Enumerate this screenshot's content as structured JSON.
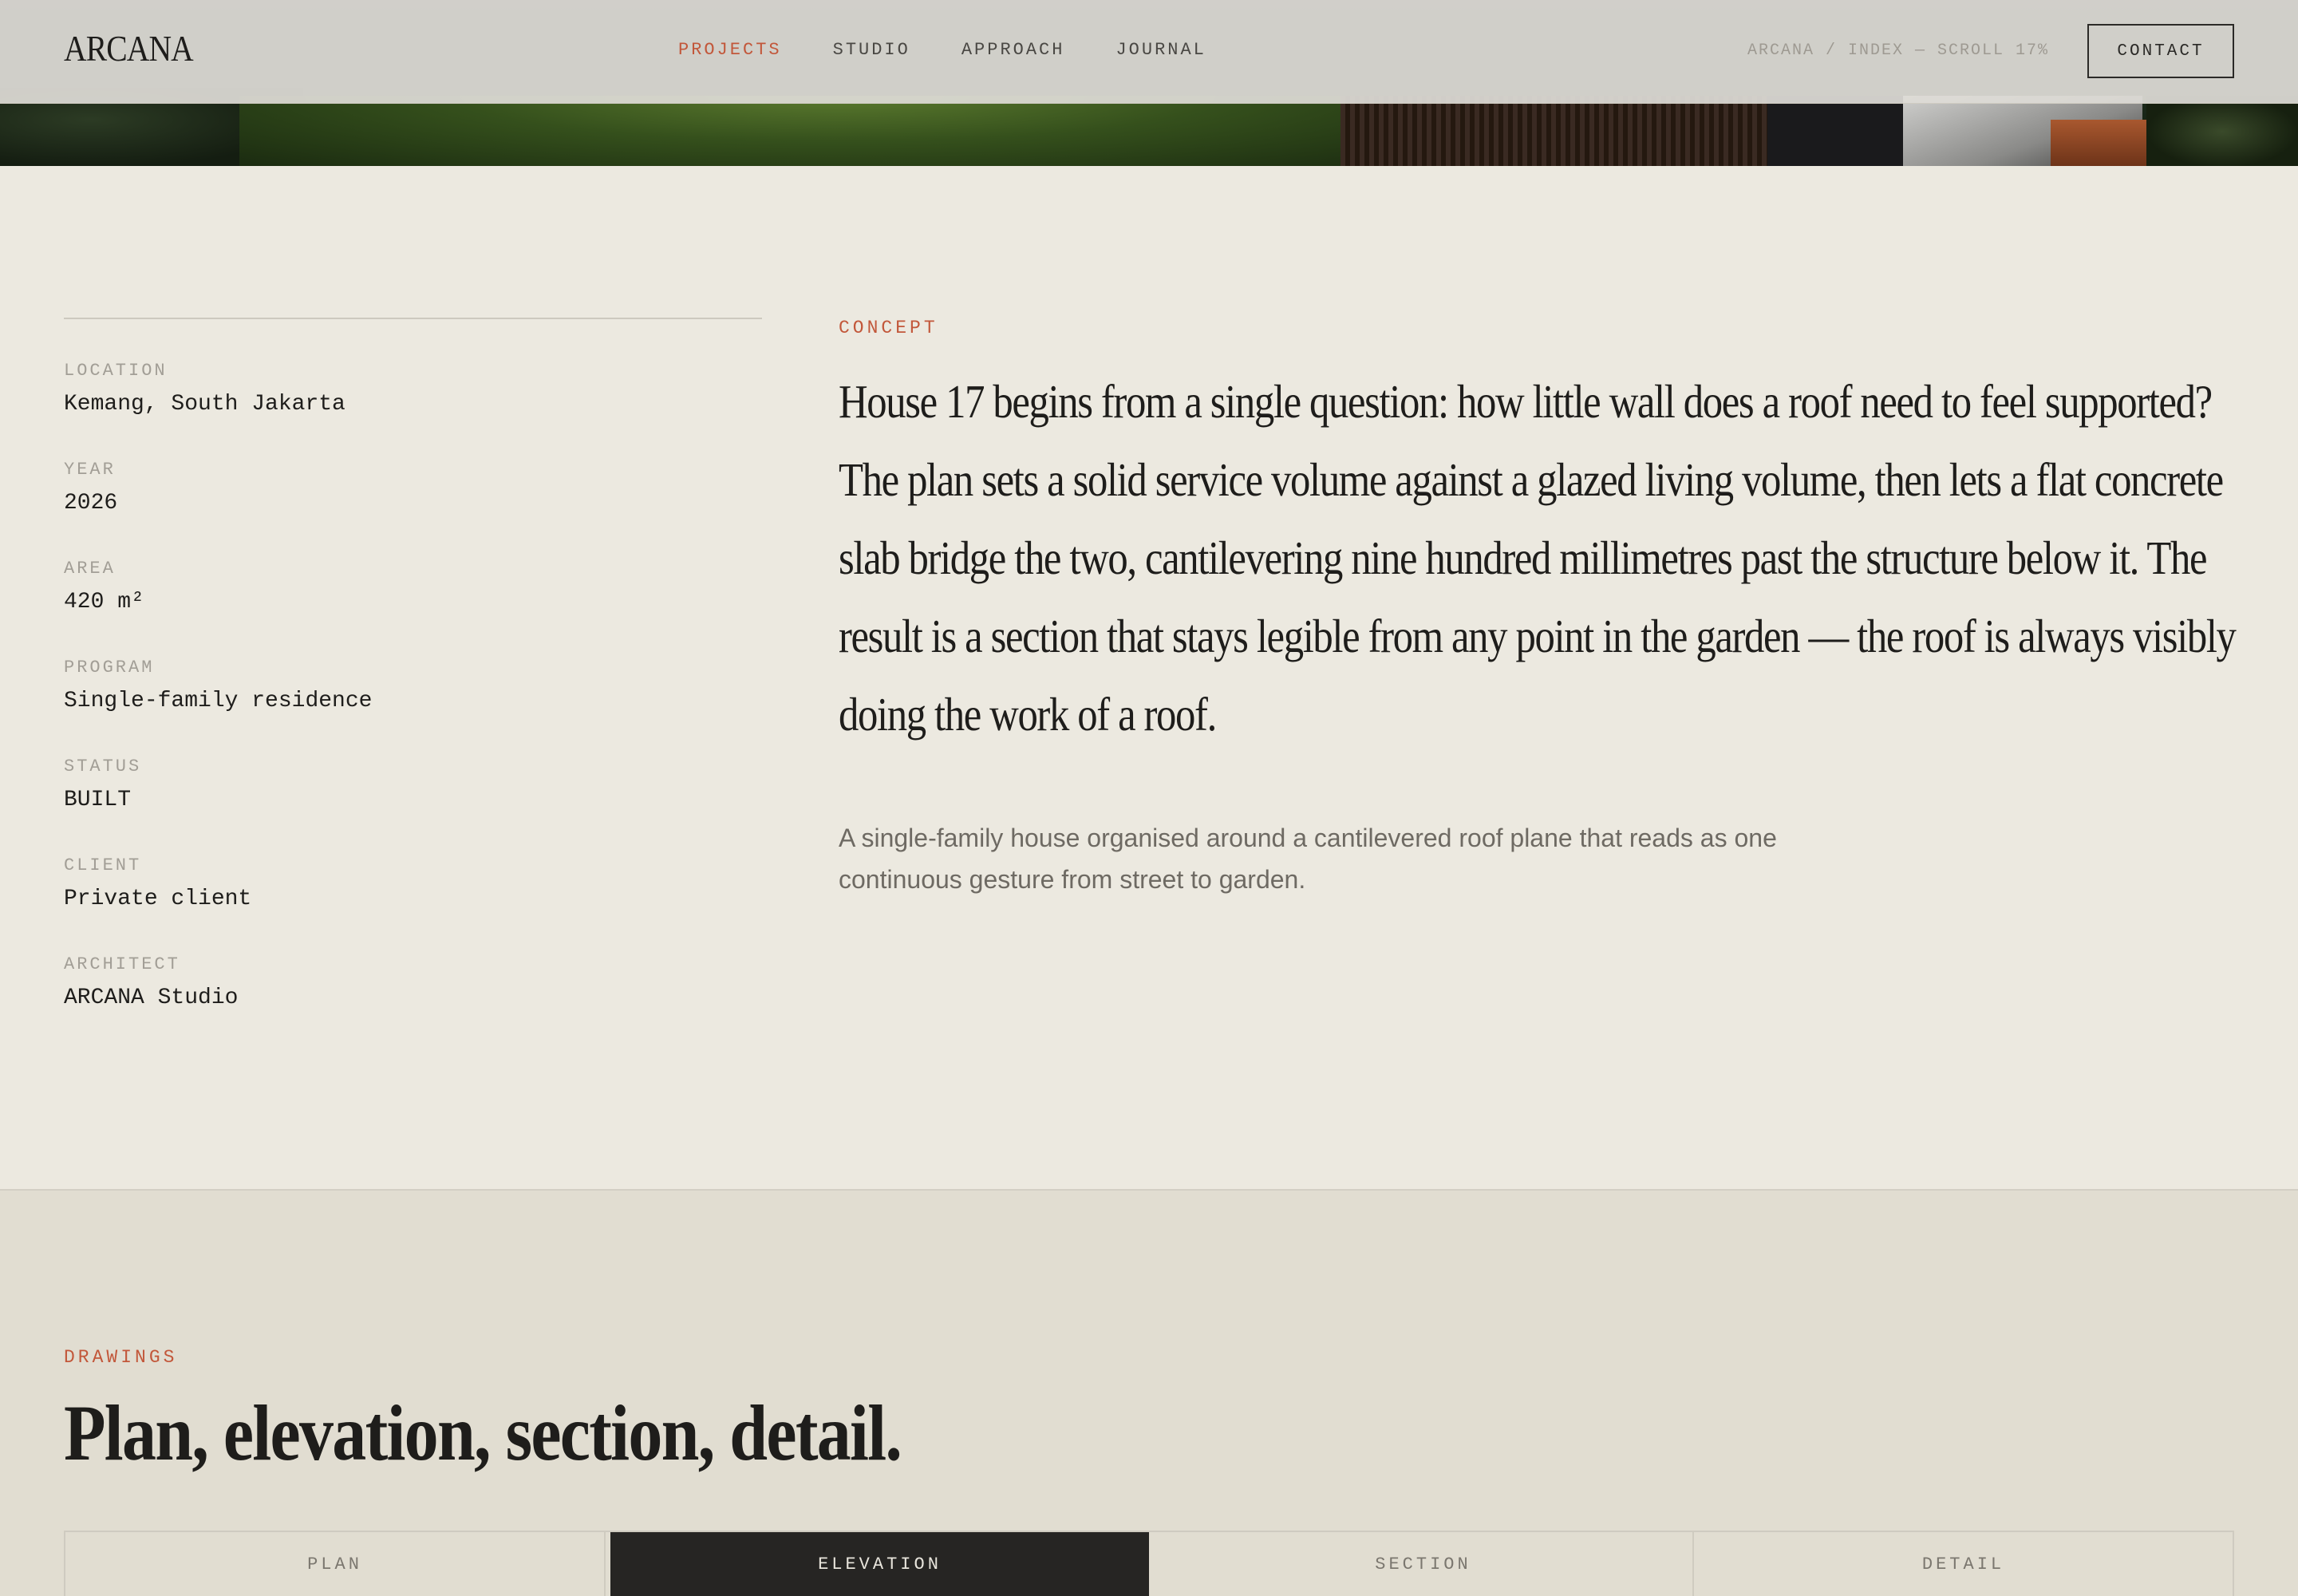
{
  "header": {
    "logo": "ARCANA",
    "nav": [
      {
        "label": "PROJECTS",
        "active": true
      },
      {
        "label": "STUDIO",
        "active": false
      },
      {
        "label": "APPROACH",
        "active": false
      },
      {
        "label": "JOURNAL",
        "active": false
      }
    ],
    "crumb": "ARCANA / INDEX — SCROLL 17%",
    "contact_label": "CONTACT"
  },
  "facts": [
    {
      "label": "LOCATION",
      "value": "Kemang, South Jakarta"
    },
    {
      "label": "YEAR",
      "value": "2026"
    },
    {
      "label": "AREA",
      "value": "420 m²"
    },
    {
      "label": "PROGRAM",
      "value": "Single-family residence"
    },
    {
      "label": "STATUS",
      "value": "BUILT"
    },
    {
      "label": "CLIENT",
      "value": "Private client"
    },
    {
      "label": "ARCHITECT",
      "value": "ARCANA Studio"
    }
  ],
  "concept": {
    "eyebrow": "CONCEPT",
    "text": "House 17 begins from a single question: how little wall does a roof need to feel supported? The plan sets a solid service volume against a glazed living volume, then lets a flat concrete slab bridge the two, cantilevering nine hundred millimetres past the structure below it. The result is a section that stays legible from any point in the garden — the roof is always visibly doing the work of a roof.",
    "sub": "A single-family house organised around a cantilevered roof plane that reads as one continuous gesture from street to garden."
  },
  "drawings": {
    "eyebrow": "DRAWINGS",
    "title": "Plan, elevation, section, detail.",
    "tabs": [
      {
        "label": "PLAN",
        "active": false
      },
      {
        "label": "ELEVATION",
        "active": true
      },
      {
        "label": "SECTION",
        "active": false
      },
      {
        "label": "DETAIL",
        "active": false
      }
    ]
  },
  "colors": {
    "accent": "#C2573A",
    "background": "#ECE9E0",
    "drawings_background": "#E1DDD1",
    "ink": "#1E1D1B"
  }
}
